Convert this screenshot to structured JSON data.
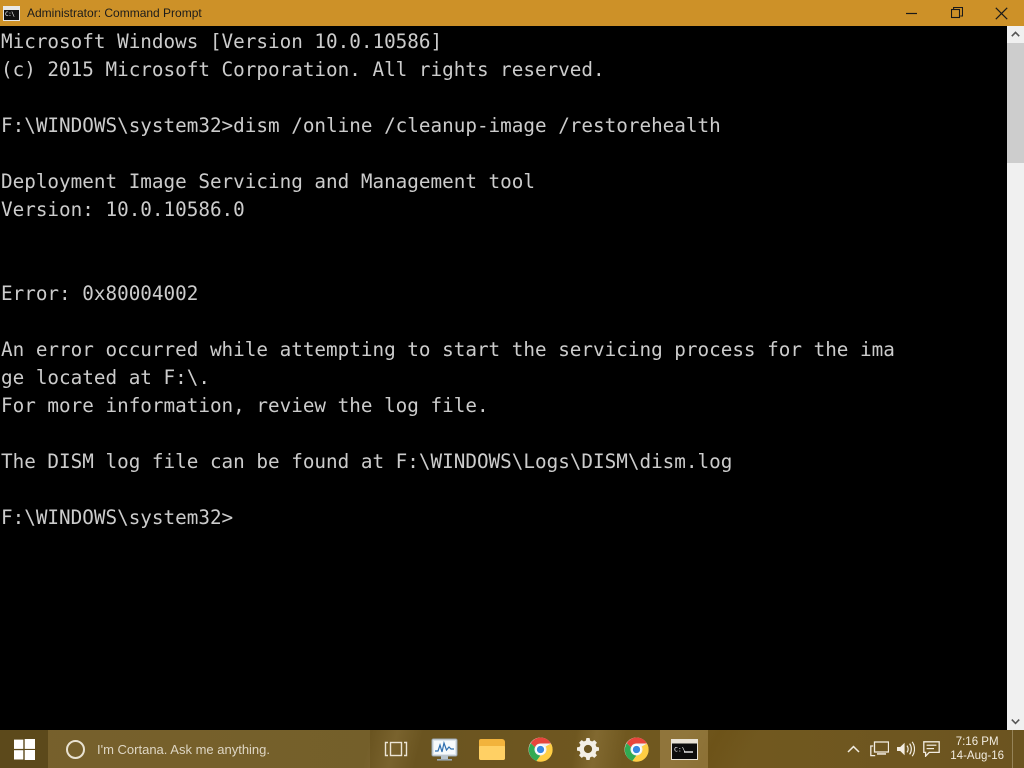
{
  "window": {
    "title": "Administrator: Command Prompt",
    "icon": "console-icon",
    "titlebar_color": "#cd9128",
    "console_bg": "#000000",
    "console_fg": "#cccccc",
    "controls": {
      "minimize": "minimize-button",
      "maximize": "restore-button",
      "close": "close-button"
    }
  },
  "console": {
    "lines": [
      "Microsoft Windows [Version 10.0.10586]",
      "(c) 2015 Microsoft Corporation. All rights reserved.",
      "",
      "F:\\WINDOWS\\system32>dism /online /cleanup-image /restorehealth",
      "",
      "Deployment Image Servicing and Management tool",
      "Version: 10.0.10586.0",
      "",
      "",
      "Error: 0x80004002",
      "",
      "An error occurred while attempting to start the servicing process for the ima",
      "ge located at F:\\.",
      "For more information, review the log file.",
      "",
      "The DISM log file can be found at F:\\WINDOWS\\Logs\\DISM\\dism.log",
      "",
      "F:\\WINDOWS\\system32>"
    ],
    "text": "Microsoft Windows [Version 10.0.10586]\n(c) 2015 Microsoft Corporation. All rights reserved.\n\nF:\\WINDOWS\\system32>dism /online /cleanup-image /restorehealth\n\nDeployment Image Servicing and Management tool\nVersion: 10.0.10586.0\n\n\nError: 0x80004002\n\nAn error occurred while attempting to start the servicing process for the ima\nge located at F:\\.\nFor more information, review the log file.\n\nThe DISM log file can be found at F:\\WINDOWS\\Logs\\DISM\\dism.log\n\nF:\\WINDOWS\\system32>",
    "command": "dism /online /cleanup-image /restorehealth",
    "prompt": "F:\\WINDOWS\\system32>",
    "error_code": "0x80004002",
    "log_path": "F:\\WINDOWS\\Logs\\DISM\\dism.log"
  },
  "scrollbar": {
    "up_arrow": "scroll-up-arrow",
    "down_arrow": "scroll-down-arrow",
    "thumb": "scroll-thumb"
  },
  "taskbar": {
    "start": "windows-logo-icon",
    "cortana": {
      "icon": "cortana-ring-icon",
      "placeholder": "I'm Cortana. Ask me anything."
    },
    "items": [
      {
        "name": "task-view",
        "label": "Task View"
      },
      {
        "name": "task-manager",
        "label": "Task Manager"
      },
      {
        "name": "file-explorer",
        "label": "File Explorer"
      },
      {
        "name": "google-chrome",
        "label": "Google Chrome"
      },
      {
        "name": "settings",
        "label": "Settings"
      },
      {
        "name": "google-chrome-2",
        "label": "Google Chrome"
      },
      {
        "name": "command-prompt",
        "label": "Administrator: Command Prompt",
        "active": true
      }
    ],
    "tray": {
      "icons": [
        "show-hidden-icons",
        "network-icon",
        "volume-icon",
        "action-center-icon"
      ],
      "time": "7:16 PM",
      "date": "14-Aug-16"
    }
  }
}
